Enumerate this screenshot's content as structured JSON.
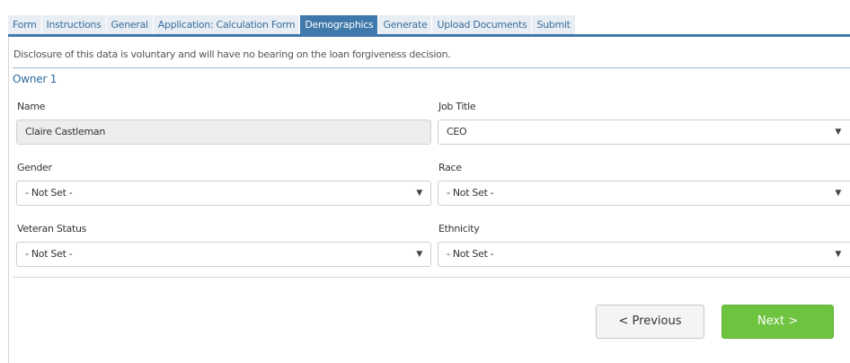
{
  "tabs": [
    {
      "label": "Form",
      "active": false
    },
    {
      "label": "Instructions",
      "active": false
    },
    {
      "label": "General",
      "active": false
    },
    {
      "label": "Application: Calculation Form",
      "active": false
    },
    {
      "label": "Demographics",
      "active": true
    },
    {
      "label": "Generate",
      "active": false
    },
    {
      "label": "Upload Documents",
      "active": false
    },
    {
      "label": "Submit",
      "active": false
    }
  ],
  "disclosure": "Disclosure of this data is voluntary and will have no bearing on the loan forgiveness decision.",
  "owner_title": "Owner 1",
  "fields": {
    "name": {
      "label": "Name",
      "value": "Claire Castleman"
    },
    "job_title": {
      "label": "Job Title",
      "value": "CEO"
    },
    "gender": {
      "label": "Gender",
      "value": "- Not Set -"
    },
    "race": {
      "label": "Race",
      "value": "- Not Set -"
    },
    "veteran_status": {
      "label": "Veteran Status",
      "value": "- Not Set -"
    },
    "ethnicity": {
      "label": "Ethnicity",
      "value": "- Not Set -"
    }
  },
  "dropdown_arrow": "▼",
  "buttons": {
    "previous": "< Previous",
    "next": "Next >"
  },
  "colors": {
    "tab_active_bg": "#3f78aa",
    "tab_inactive_bg": "#e8eef4",
    "next_button": "#6ec33f",
    "owner_title": "#2c6aa0"
  }
}
